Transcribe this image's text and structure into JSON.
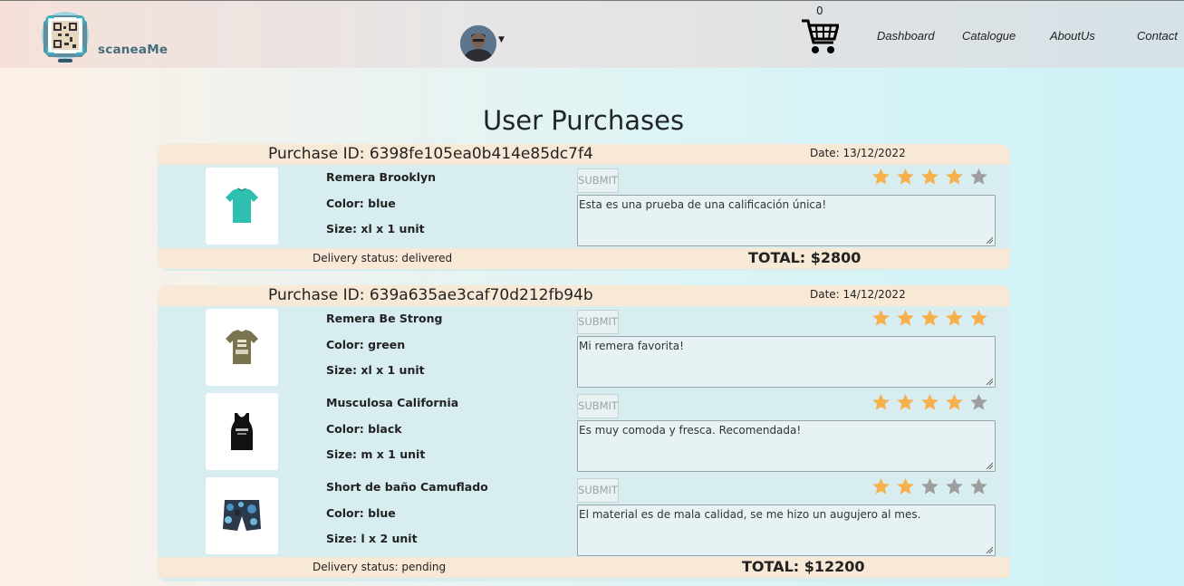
{
  "brand": {
    "name": "scaneaMe"
  },
  "nav": {
    "cart_count": "0",
    "links": [
      "Dashboard",
      "Catalogue",
      "AboutUs",
      "Contact"
    ]
  },
  "page": {
    "title": "User Purchases"
  },
  "colors": {
    "star_on": "#f7b14c",
    "star_off": "#9e9e9e",
    "panel": "#d8edf0",
    "band": "#f8e8d6"
  },
  "purchases": [
    {
      "id_label": "Purchase ID: 6398fe105ea0b414e85dc7f4",
      "date_label": "Date: 13/12/2022",
      "status_label": "Delivery status: delivered",
      "total_label": "TOTAL: $2800",
      "items": [
        {
          "name": "Remera Brooklyn",
          "color_label": "Color: blue",
          "size_label": "Size: xl x 1 unit",
          "submit_label": "SUBMIT",
          "review": "Esta es una prueba de una calificación única!",
          "rating": 4,
          "icon": "tshirt-teal"
        }
      ]
    },
    {
      "id_label": "Purchase ID: 639a635ae3caf70d212fb94b",
      "date_label": "Date: 14/12/2022",
      "status_label": "Delivery status: pending",
      "total_label": "TOTAL: $12200",
      "items": [
        {
          "name": "Remera Be Strong",
          "color_label": "Color: green",
          "size_label": "Size: xl x 1 unit",
          "submit_label": "SUBMIT",
          "review": "Mi remera favorita!",
          "rating": 5,
          "icon": "tshirt-olive"
        },
        {
          "name": "Musculosa California",
          "color_label": "Color: black",
          "size_label": "Size: m x 1 unit",
          "submit_label": "SUBMIT",
          "review": "Es muy comoda y fresca. Recomendada!",
          "rating": 4,
          "icon": "tank-top-black"
        },
        {
          "name": "Short de baño Camuflado",
          "color_label": "Color: blue",
          "size_label": "Size: l x 2 unit",
          "submit_label": "SUBMIT",
          "review": "El material es de mala calidad, se me hizo un augujero al mes.",
          "rating": 2,
          "icon": "swim-shorts-camo"
        }
      ]
    }
  ]
}
